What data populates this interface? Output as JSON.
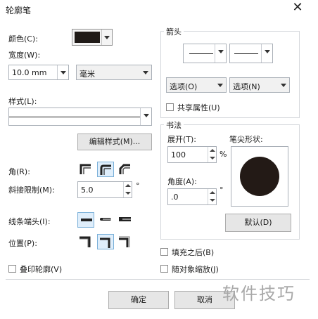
{
  "window": {
    "title": "轮廓笔",
    "close_glyph": "✕"
  },
  "left": {
    "color_label": "颜色(C):",
    "color_swatch": "#1f1a17",
    "width_label": "宽度(W):",
    "width_value": "10.0 mm",
    "unit_value": "毫米",
    "style_label": "样式(L):",
    "edit_style_button": "编辑样式(M)...",
    "corner_label": "角(R):",
    "miter_label": "斜接限制(M):",
    "miter_value": "5.0",
    "miter_unit": "°",
    "linecap_label": "线条端头(I):",
    "position_label": "位置(P):",
    "overprint_label": "叠印轮廓(V)"
  },
  "arrows": {
    "group_label": "箭头",
    "option_left": "选项(O)",
    "option_right": "选项(N)",
    "share_label": "共享属性(U)"
  },
  "calligraphy": {
    "group_label": "书法",
    "stretch_label": "展开(T):",
    "stretch_value": "100",
    "stretch_unit": "%",
    "nib_label": "笔尖形状:",
    "angle_label": "角度(A):",
    "angle_value": ".0",
    "angle_unit": "°",
    "default_button": "默认(D)"
  },
  "options": {
    "behind_fill_label": "填充之后(B)",
    "scale_label": "随对象缩放(J)"
  },
  "footer": {
    "ok_button": "确定",
    "cancel_button": "取消"
  },
  "watermark": "软件技巧",
  "colors": {
    "accent_select": "#dfeefb",
    "nib": "#231a16"
  }
}
